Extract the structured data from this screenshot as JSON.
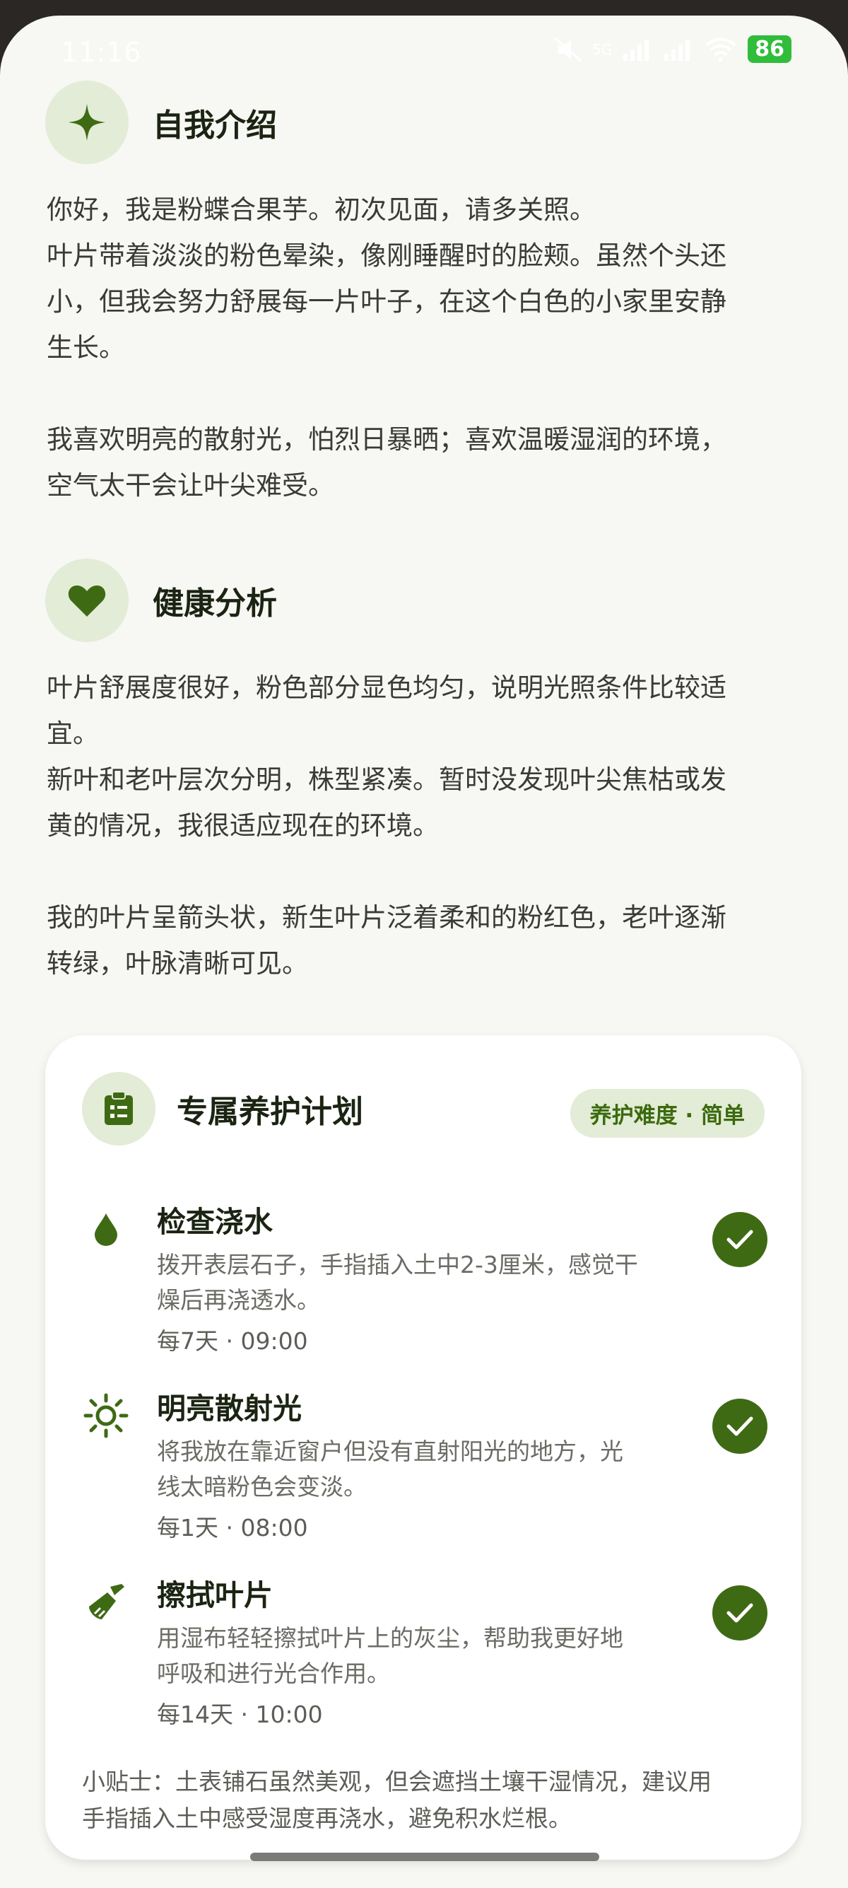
{
  "status_bar": {
    "time": "11:16",
    "battery": "86",
    "signal_label": "5G"
  },
  "intro": {
    "title": "自我介绍",
    "icon": "sparkle-icon",
    "lines": [
      "你好，我是粉蝶合果芋。初次见面，请多关照。",
      "叶片带着淡淡的粉色晕染，像刚睡醒时的脸颊。虽然个头还",
      "小，但我会努力舒展每一片叶子，在这个白色的小家里安静",
      "生长。",
      "我喜欢明亮的散射光，怕烈日暴晒；喜欢温暖湿润的环境，",
      "空气太干会让叶尖难受。"
    ]
  },
  "health": {
    "title": "健康分析",
    "icon": "heart-icon",
    "lines": [
      "叶片舒展度很好，粉色部分显色均匀，说明光照条件比较适",
      "宜。",
      "新叶和老叶层次分明，株型紧凑。暂时没发现叶尖焦枯或发",
      "黄的情况，我很适应现在的环境。",
      "我的叶片呈箭头状，新生叶片泛着柔和的粉红色，老叶逐渐",
      "转绿，叶脉清晰可见。"
    ]
  },
  "care_plan": {
    "title": "专属养护计划",
    "icon": "clipboard-icon",
    "difficulty": "养护难度 · 简单",
    "tasks": [
      {
        "icon": "water-drop-icon",
        "title": "检查浇水",
        "desc_lines": [
          "拨开表层石子，手指插入土中2-3厘米，感觉干",
          "燥后再浇透水。"
        ],
        "freq": "每7天 · 09:00",
        "done": true
      },
      {
        "icon": "sun-icon",
        "title": "明亮散射光",
        "desc_lines": [
          "将我放在靠近窗户但没有直射阳光的地方，光",
          "线太暗粉色会变淡。"
        ],
        "freq": "每1天 · 08:00",
        "done": true
      },
      {
        "icon": "broom-icon",
        "title": "擦拭叶片",
        "desc_lines": [
          "用湿布轻轻擦拭叶片上的灰尘，帮助我更好地",
          "呼吸和进行光合作用。"
        ],
        "freq": "每14天 · 10:00",
        "done": true
      }
    ],
    "tip_lines": [
      "小贴士：土表铺石虽然美观，但会遮挡土壤干湿情况，建议用",
      "手指插入土中感受湿度再浇水，避免积水烂根。"
    ]
  },
  "colors": {
    "accent": "#3f6a14",
    "accent_soft": "#e3ecd6",
    "background": "#f7f7f4",
    "card": "#ffffff"
  }
}
